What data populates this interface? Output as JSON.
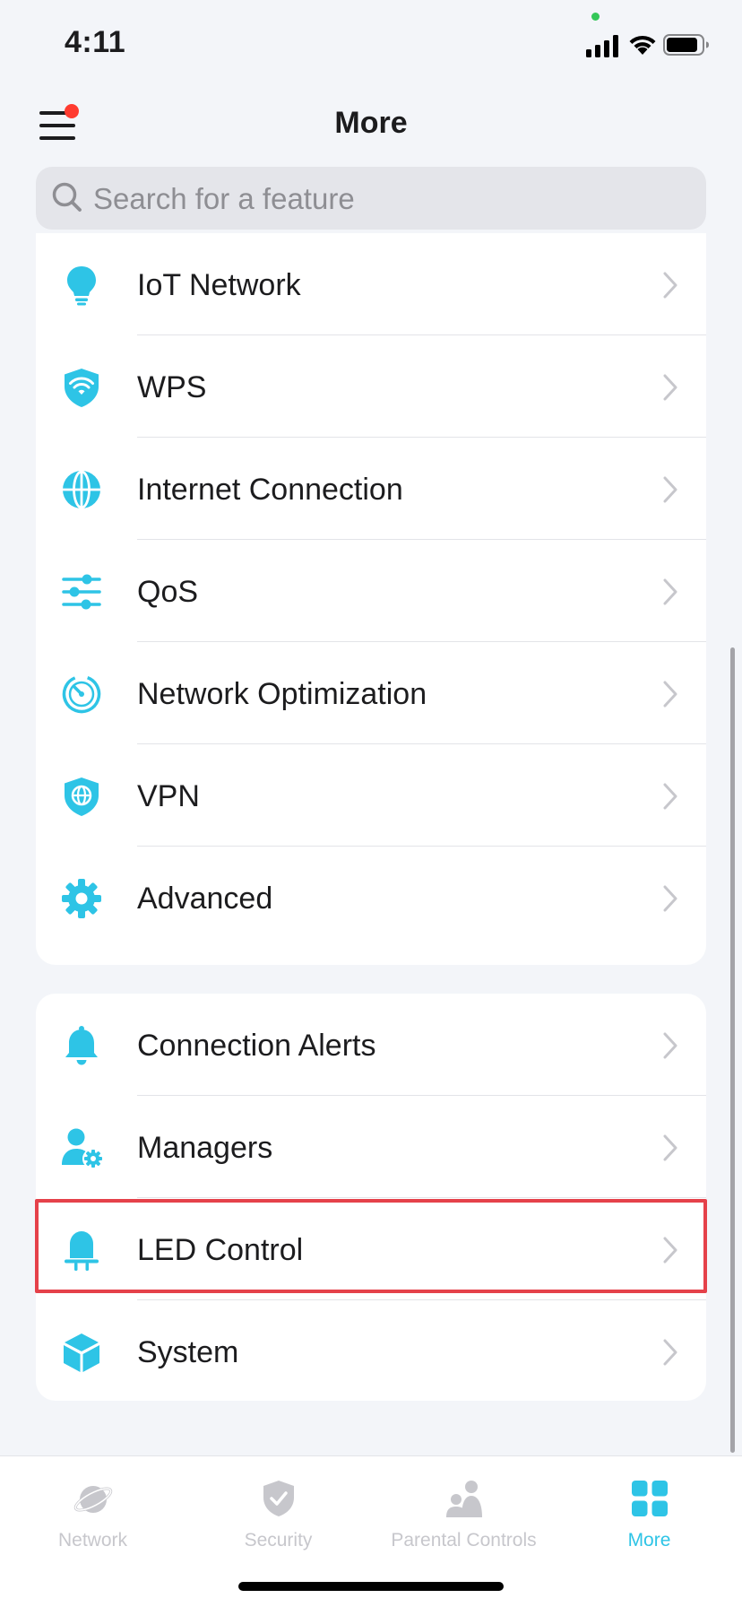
{
  "status_bar": {
    "time": "4:11"
  },
  "header": {
    "title": "More"
  },
  "search": {
    "placeholder": "Search for a feature"
  },
  "accent_color": "#2ec4e6",
  "highlight_color": "#e5414a",
  "card1": {
    "items": [
      {
        "label": "IoT Network",
        "icon": "lightbulb-icon"
      },
      {
        "label": "WPS",
        "icon": "wifi-shield-icon"
      },
      {
        "label": "Internet Connection",
        "icon": "globe-icon"
      },
      {
        "label": "QoS",
        "icon": "sliders-icon"
      },
      {
        "label": "Network Optimization",
        "icon": "speedometer-icon"
      },
      {
        "label": "VPN",
        "icon": "globe-shield-icon"
      },
      {
        "label": "Advanced",
        "icon": "gear-icon"
      }
    ]
  },
  "card2": {
    "items": [
      {
        "label": "Connection Alerts",
        "icon": "bell-icon"
      },
      {
        "label": "Managers",
        "icon": "user-gear-icon"
      },
      {
        "label": "LED Control",
        "icon": "led-icon",
        "highlighted": true
      },
      {
        "label": "System",
        "icon": "cube-icon"
      }
    ]
  },
  "tabs": [
    {
      "label": "Network",
      "icon": "planet-icon",
      "active": false
    },
    {
      "label": "Security",
      "icon": "shield-check-icon",
      "active": false
    },
    {
      "label": "Parental Controls",
      "icon": "family-icon",
      "active": false
    },
    {
      "label": "More",
      "icon": "grid-icon",
      "active": true
    }
  ]
}
